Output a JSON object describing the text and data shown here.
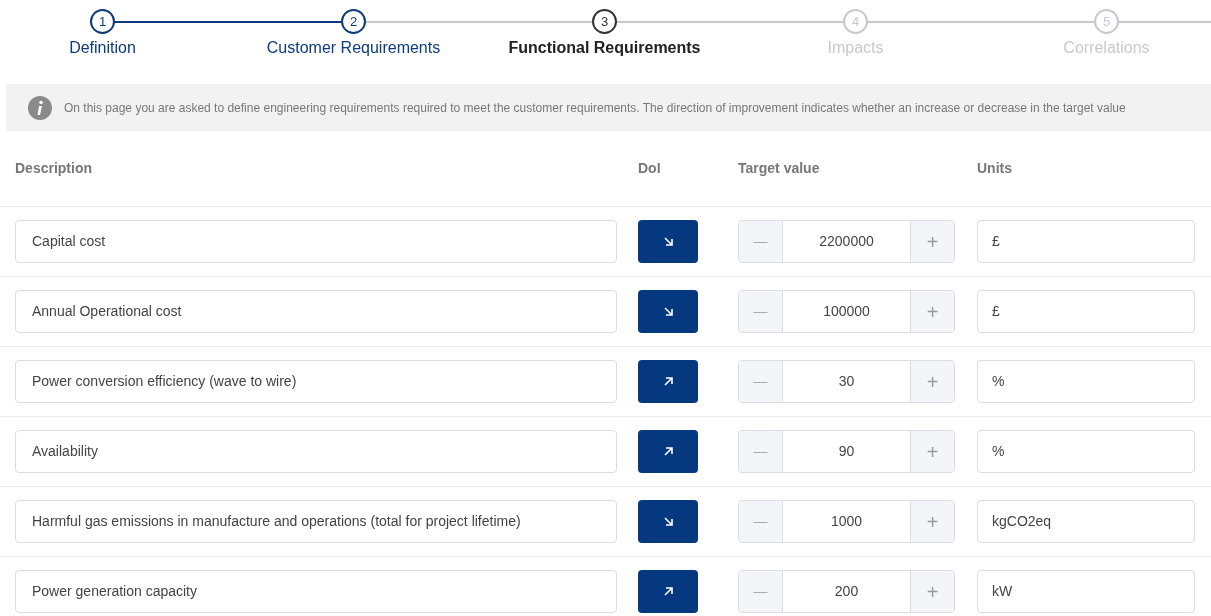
{
  "steps": [
    {
      "number": "1",
      "label": "Definition",
      "completed": true,
      "selected": false
    },
    {
      "number": "2",
      "label": "Customer Requirements",
      "completed": true,
      "selected": false
    },
    {
      "number": "3",
      "label": "Functional Requirements",
      "completed": false,
      "selected": true
    },
    {
      "number": "4",
      "label": "Impacts",
      "completed": false,
      "selected": false
    },
    {
      "number": "5",
      "label": "Correlations",
      "completed": false,
      "selected": false
    }
  ],
  "info": "On this page you are asked to define engineering requirements required to meet the customer requirements. The direction of improvement indicates whether an increase or decrease in the target value",
  "columns": [
    "Description",
    "DoI",
    "Target value",
    "Units"
  ],
  "rows": [
    {
      "description": "Capital cost",
      "kind": "decrease",
      "minus": "—",
      "value": "2200000",
      "plus": "+",
      "units": "£"
    },
    {
      "description": "Annual Operational cost",
      "kind": "decrease",
      "minus": "—",
      "value": "100000",
      "plus": "+",
      "units": "£"
    },
    {
      "description": "Power conversion efficiency (wave to wire)",
      "kind": "increase",
      "minus": "—",
      "value": "30",
      "plus": "+",
      "units": "%"
    },
    {
      "description": "Availability",
      "kind": "increase",
      "minus": "—",
      "value": "90",
      "plus": "+",
      "units": "%"
    },
    {
      "description": "Harmful gas emissions in manufacture and operations (total for project lifetime)",
      "kind": "decrease",
      "minus": "—",
      "value": "1000",
      "plus": "+",
      "units": "kgCO2eq"
    },
    {
      "description": "Power generation capacity",
      "kind": "increase",
      "minus": "—",
      "value": "200",
      "plus": "+",
      "units": "kW"
    }
  ]
}
